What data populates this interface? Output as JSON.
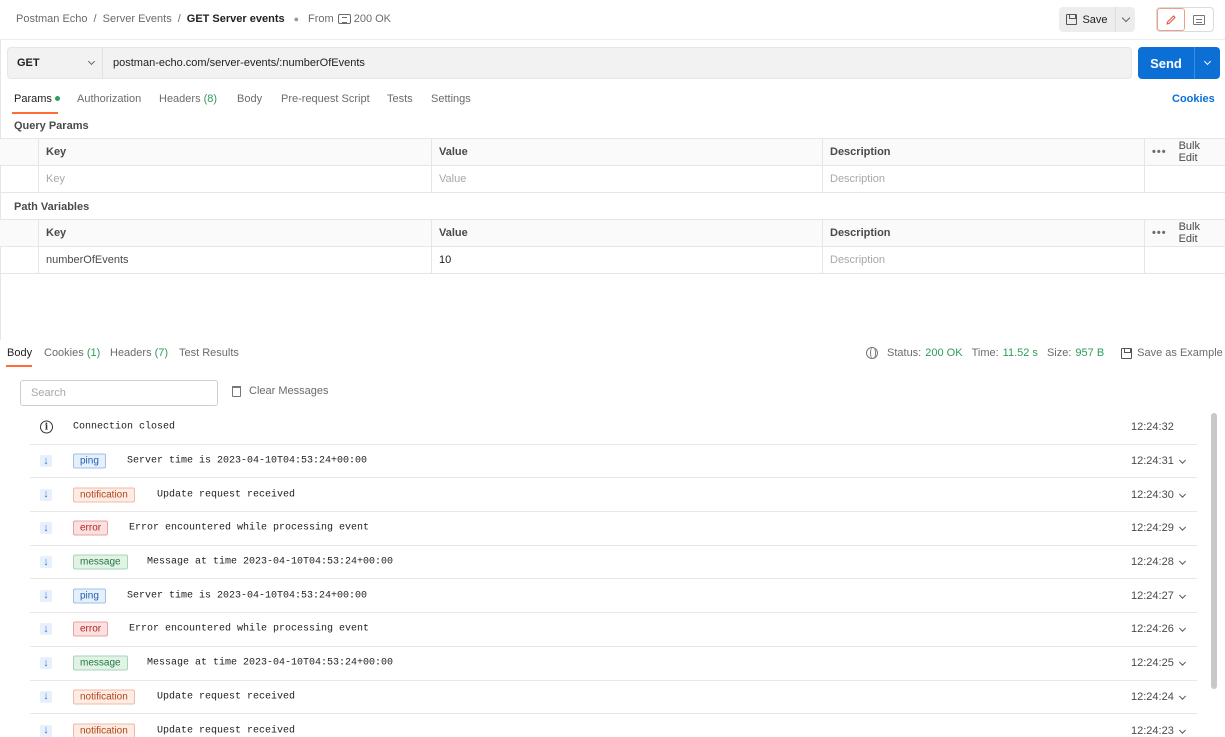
{
  "breadcrumb": {
    "items": [
      "Postman Echo",
      "Server Events"
    ],
    "current": "GET Server events",
    "from_label": "From",
    "from_status": "200 OK"
  },
  "toolbar": {
    "save_label": "Save"
  },
  "request": {
    "method": "GET",
    "url": "postman-echo.com/server-events/:numberOfEvents",
    "send_label": "Send"
  },
  "request_tabs": {
    "params": "Params",
    "authorization": "Authorization",
    "headers": "Headers",
    "headers_count": "(8)",
    "body": "Body",
    "pre_request_script": "Pre-request Script",
    "tests": "Tests",
    "settings": "Settings",
    "cookies": "Cookies"
  },
  "query_params": {
    "title": "Query Params",
    "columns": {
      "key": "Key",
      "value": "Value",
      "description": "Description",
      "bulk_edit": "Bulk Edit"
    },
    "empty_row": {
      "key_placeholder": "Key",
      "value_placeholder": "Value",
      "description_placeholder": "Description"
    }
  },
  "path_variables": {
    "title": "Path Variables",
    "columns": {
      "key": "Key",
      "value": "Value",
      "description": "Description",
      "bulk_edit": "Bulk Edit"
    },
    "rows": [
      {
        "key": "numberOfEvents",
        "value": "10",
        "description_placeholder": "Description"
      }
    ]
  },
  "response_tabs": {
    "body": "Body",
    "cookies": "Cookies",
    "cookies_count": "(1)",
    "headers": "Headers",
    "headers_count": "(7)",
    "test_results": "Test Results"
  },
  "response_meta": {
    "status_label": "Status:",
    "status_value": "200 OK",
    "time_label": "Time:",
    "time_value": "11.52 s",
    "size_label": "Size:",
    "size_value": "957 B",
    "save_example": "Save as Example"
  },
  "events": {
    "search_placeholder": "Search",
    "clear_label": "Clear Messages",
    "connection_closed": {
      "text": "Connection closed",
      "time": "12:24:32"
    },
    "messages": [
      {
        "type": "ping",
        "text": "Server time is 2023-04-10T04:53:24+00:00",
        "time": "12:24:31"
      },
      {
        "type": "notification",
        "text": "Update request received",
        "time": "12:24:30"
      },
      {
        "type": "error",
        "text": "Error encountered while processing event",
        "time": "12:24:29"
      },
      {
        "type": "message",
        "text": "Message at time 2023-04-10T04:53:24+00:00",
        "time": "12:24:28"
      },
      {
        "type": "ping",
        "text": "Server time is 2023-04-10T04:53:24+00:00",
        "time": "12:24:27"
      },
      {
        "type": "error",
        "text": "Error encountered while processing event",
        "time": "12:24:26"
      },
      {
        "type": "message",
        "text": "Message at time 2023-04-10T04:53:24+00:00",
        "time": "12:24:25"
      },
      {
        "type": "notification",
        "text": "Update request received",
        "time": "12:24:24"
      },
      {
        "type": "notification",
        "text": "Update request received",
        "time": "12:24:23"
      }
    ]
  },
  "colors": {
    "accent": "#ff6c37",
    "send": "#0b6fd6",
    "success": "#2e9d58"
  }
}
